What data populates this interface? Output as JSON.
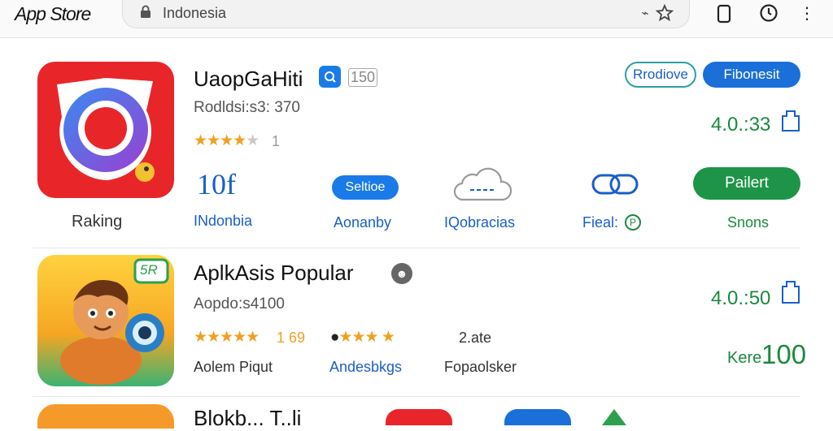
{
  "header": {
    "logo": "App Store",
    "address": "Indonesia"
  },
  "app1": {
    "title": "UaopGaHiti",
    "badge_num": "150",
    "subtitle": "Rodldsi:s3: 370",
    "stars_count": "1",
    "pill_outline": "Rrodiove",
    "pill_filled": "Fibonesit",
    "version": "4.0.:33",
    "icon_label": "Raking",
    "stats": [
      {
        "value": "10f",
        "label": "INdonbia"
      },
      {
        "value": "Seltioe",
        "label": "Aonanby"
      },
      {
        "value": "",
        "label": "IQobracias"
      },
      {
        "value": "",
        "label": "Fieal:"
      }
    ],
    "action_button": "Pailert",
    "action_label": "Snons"
  },
  "app2": {
    "title": "AplkAsis Popular",
    "icon_badge": "5R",
    "subtitle": "Aopdo:s4100",
    "rating_a_num": "1 69",
    "rating_c_label": "2.ate",
    "version": "4.0.:50",
    "bottom_labels": [
      "Aolem Piqut",
      "Andesbkgs",
      "Fopaolsker"
    ],
    "price_label": "Kere",
    "price_value": "100"
  },
  "app3": {
    "title_partial": "Blokb... T..li"
  },
  "colors": {
    "accent_blue": "#1a5fc9",
    "accent_green": "#1b8a3e",
    "star": "#f0a020"
  }
}
